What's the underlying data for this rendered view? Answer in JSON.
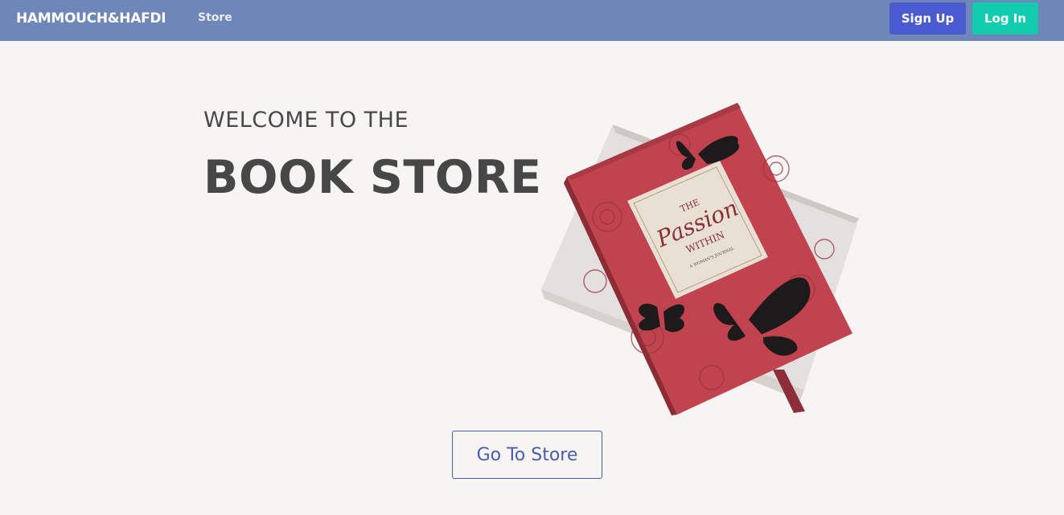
{
  "navbar": {
    "brand": "HAMMOUCH&HAFDI",
    "store_link": "Store",
    "signup_label": "Sign Up",
    "login_label": "Log In"
  },
  "hero": {
    "welcome_text": "WELCOME TO THE",
    "title": "BOOK STORE",
    "cta_label": "Go To Store",
    "image": {
      "book_title_line1": "THE",
      "book_title_line2": "Passion",
      "book_title_line3": "WITHIN",
      "book_subtitle": "A WOMAN'S JOURNAL"
    }
  },
  "colors": {
    "navbar": "#6f86b8",
    "signup": "#4a5bcf",
    "login": "#12ccb0",
    "accent": "#4a5bb0",
    "background": "#f7f5f4",
    "book_cover": "#c0434f"
  }
}
